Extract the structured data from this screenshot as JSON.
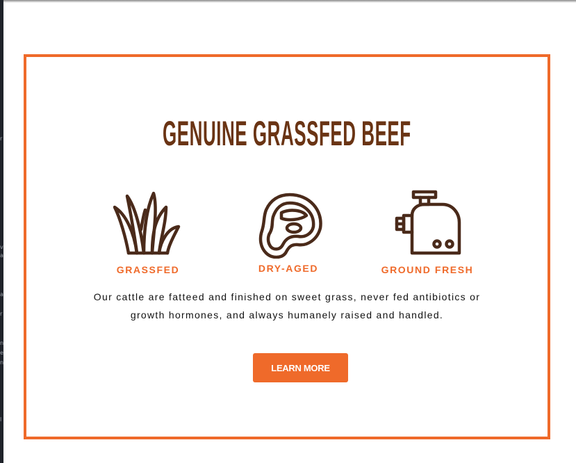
{
  "promo": {
    "headline": "GENUINE GRASSFED BEEF",
    "features": [
      {
        "label": "GRASSFED",
        "icon": "grass-icon"
      },
      {
        "label": "DRY-AGED",
        "icon": "steak-icon"
      },
      {
        "label": "GROUND FRESH",
        "icon": "meat-grinder-icon"
      }
    ],
    "description": "Our cattle are fatteed and finished on sweet grass, never fed antibiotics or growth hormones, and always humanely raised and handled.",
    "cta_label": "LEARN MORE"
  },
  "colors": {
    "accent": "#ef6a2a",
    "headline": "#6a3414",
    "icon_stroke": "#4a2a1a",
    "body_text": "#111111"
  }
}
